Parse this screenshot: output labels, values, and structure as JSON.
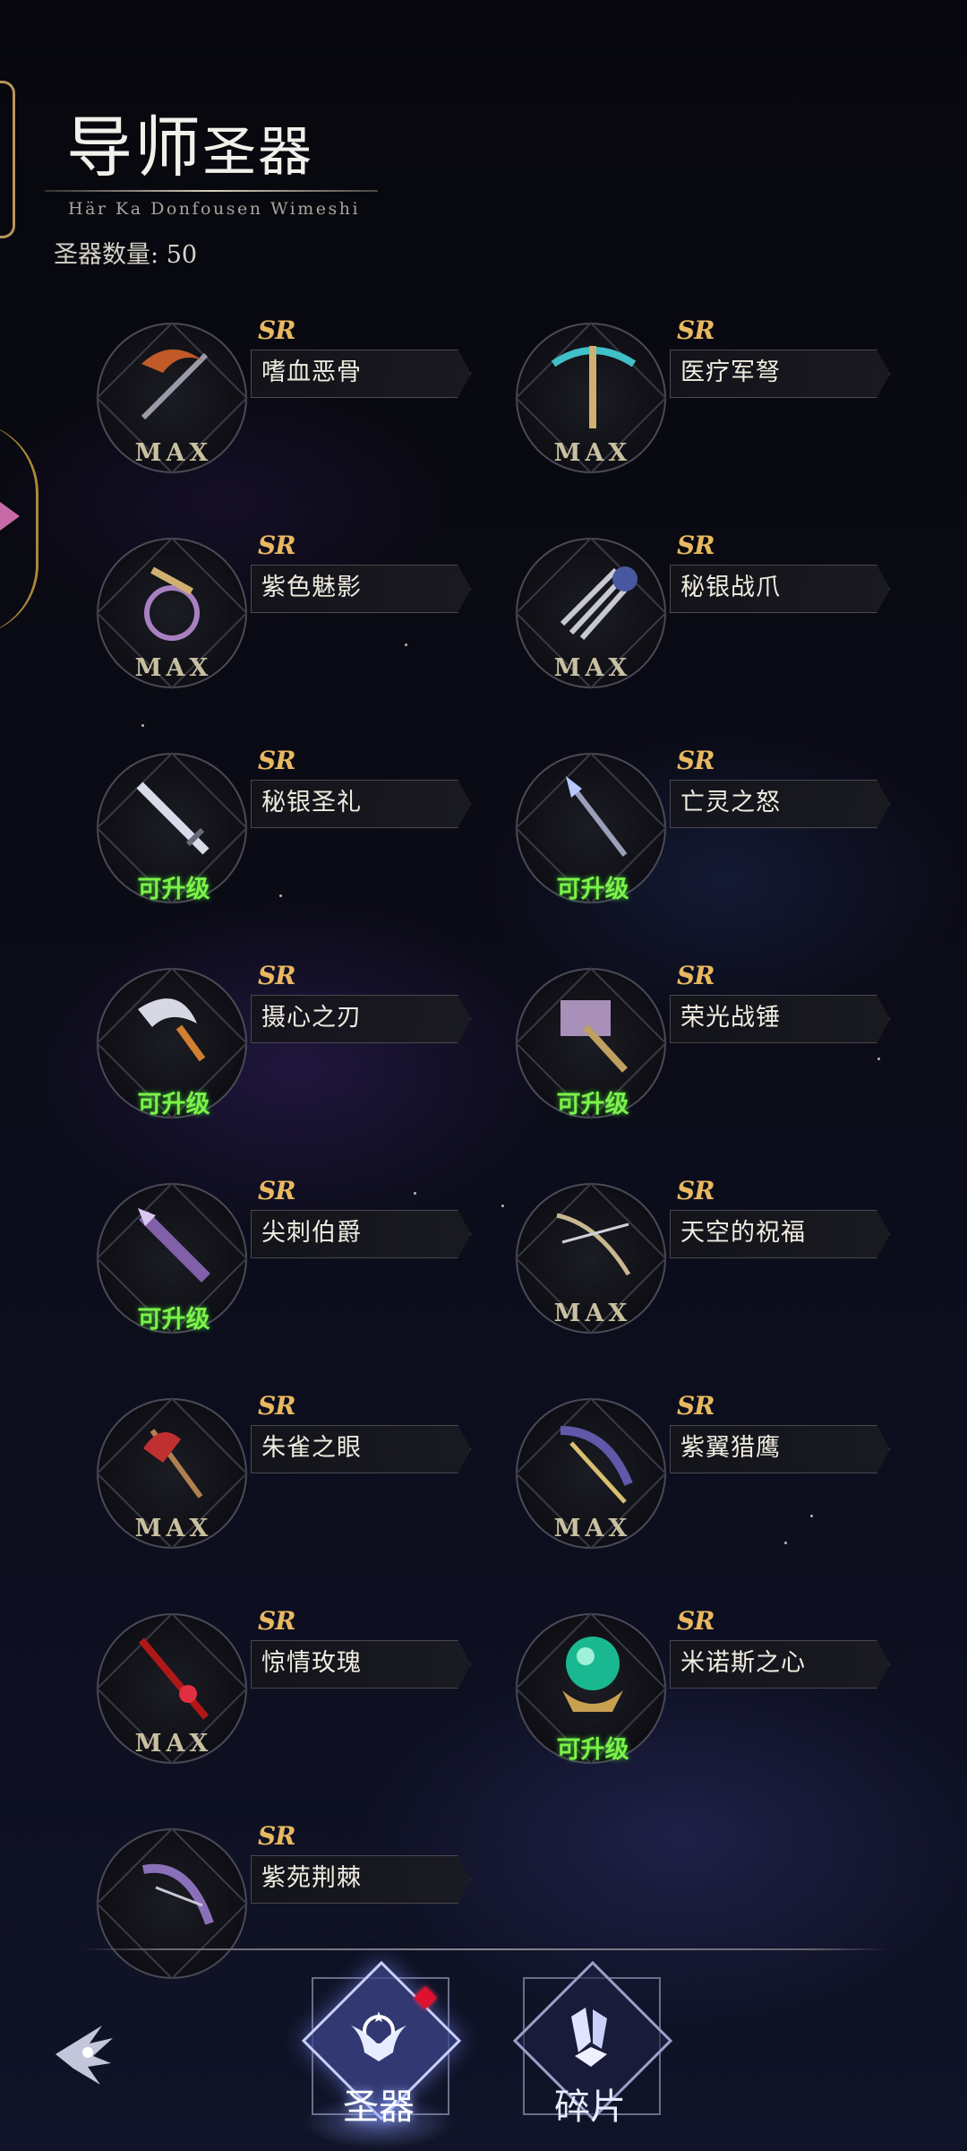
{
  "header": {
    "title_big": "导师",
    "title_small": "圣器",
    "subtitle": "Här Ka Donfousen Wimeshi",
    "count_label": "圣器数量:",
    "count_value": "50"
  },
  "colors": {
    "max": "#c8c0a0",
    "upgradable": "#7cf24a",
    "rarity": "#e8b860"
  },
  "relics": [
    {
      "rarity": "SR",
      "name": "嗜血恶骨",
      "status": "MAX",
      "icon": "scythe-icon"
    },
    {
      "rarity": "SR",
      "name": "医疗军弩",
      "status": "MAX",
      "icon": "crossbow-icon"
    },
    {
      "rarity": "SR",
      "name": "紫色魅影",
      "status": "MAX",
      "icon": "whip-icon"
    },
    {
      "rarity": "SR",
      "name": "秘银战爪",
      "status": "MAX",
      "icon": "claw-icon"
    },
    {
      "rarity": "SR",
      "name": "秘银圣礼",
      "status": "可升级",
      "icon": "sword-icon"
    },
    {
      "rarity": "SR",
      "name": "亡灵之怒",
      "status": "可升级",
      "icon": "spear-icon"
    },
    {
      "rarity": "SR",
      "name": "摄心之刃",
      "status": "可升级",
      "icon": "blade-icon"
    },
    {
      "rarity": "SR",
      "name": "荣光战锤",
      "status": "可升级",
      "icon": "hammer-icon"
    },
    {
      "rarity": "SR",
      "name": "尖刺伯爵",
      "status": "可升级",
      "icon": "lance-icon"
    },
    {
      "rarity": "SR",
      "name": "天空的祝福",
      "status": "MAX",
      "icon": "bow-icon"
    },
    {
      "rarity": "SR",
      "name": "朱雀之眼",
      "status": "MAX",
      "icon": "axe-icon"
    },
    {
      "rarity": "SR",
      "name": "紫翼猎鹰",
      "status": "MAX",
      "icon": "wing-bow-icon"
    },
    {
      "rarity": "SR",
      "name": "惊情玫瑰",
      "status": "MAX",
      "icon": "rose-spear-icon"
    },
    {
      "rarity": "SR",
      "name": "米诺斯之心",
      "status": "可升级",
      "icon": "orb-icon"
    },
    {
      "rarity": "SR",
      "name": "紫苑荆棘",
      "status": "",
      "icon": "thorn-bow-icon"
    }
  ],
  "tabs": [
    {
      "label": "圣器",
      "active": true,
      "icon": "relic-emblem-icon"
    },
    {
      "label": "碎片",
      "active": false,
      "icon": "crystal-shard-icon"
    }
  ],
  "back_icon": "back-wing-icon"
}
